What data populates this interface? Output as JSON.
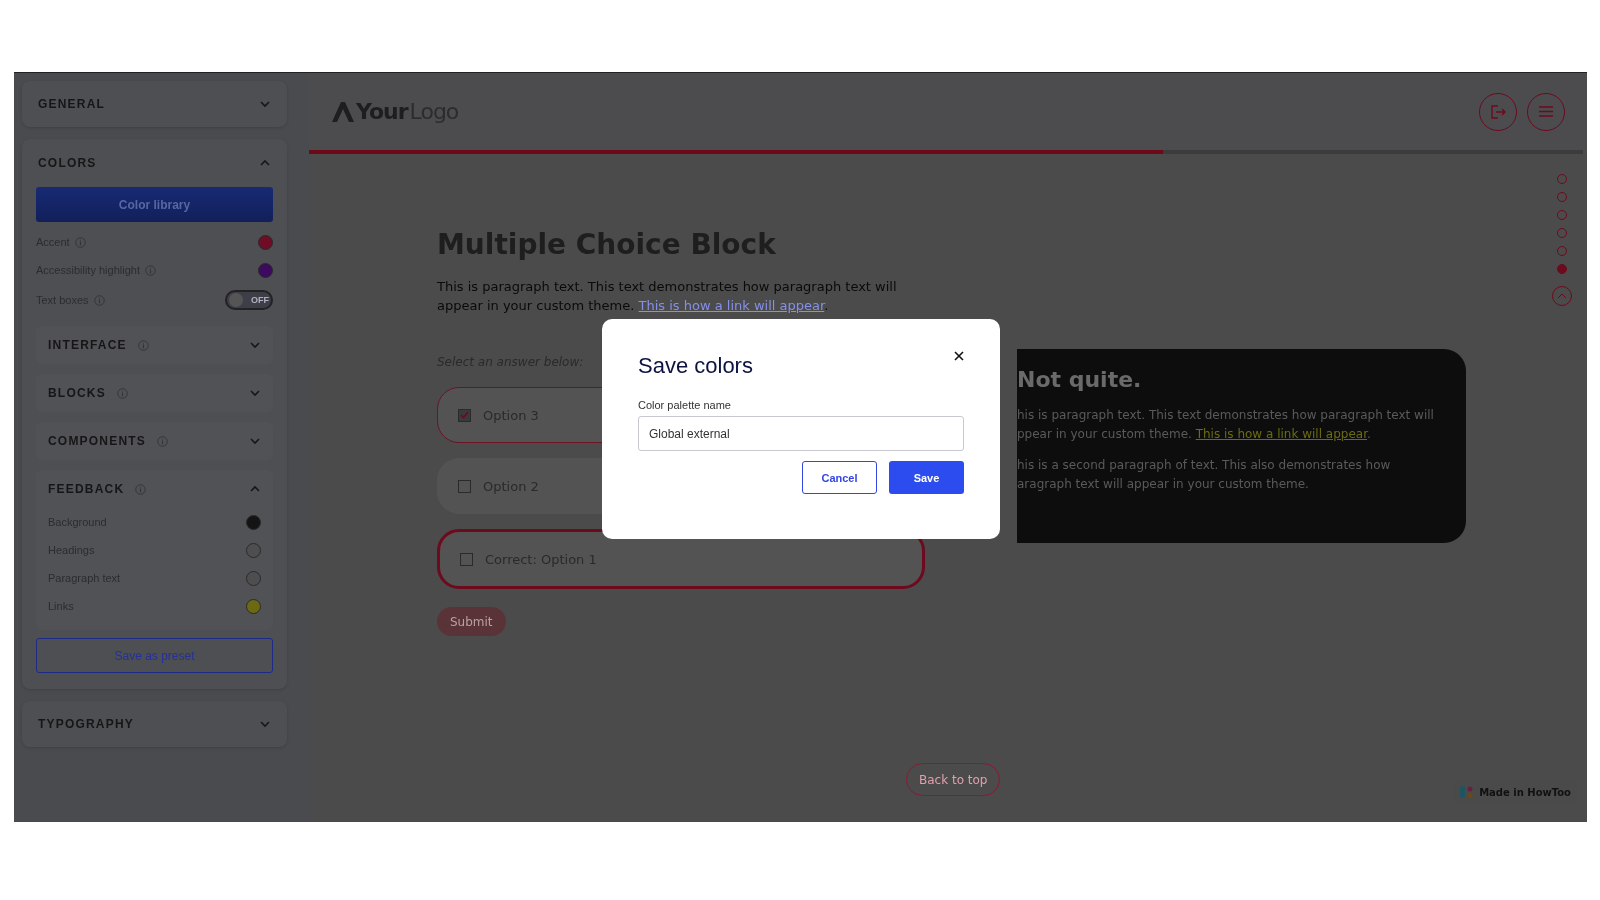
{
  "sidebar": {
    "sections": [
      {
        "title": "GENERAL",
        "expanded": false
      },
      {
        "title": "COLORS",
        "expanded": true,
        "library_button": "Color library",
        "items": [
          {
            "kind": "color",
            "label": "Accent",
            "info": true,
            "color": "#6e0d25"
          },
          {
            "kind": "color",
            "label": "Accessibility highlight",
            "info": true,
            "color": "#3c0a5e"
          },
          {
            "kind": "toggle",
            "label": "Text boxes",
            "info": true,
            "on": false,
            "state_label": "OFF"
          }
        ],
        "subsections": [
          {
            "title": "INTERFACE",
            "info": true,
            "expanded": false
          },
          {
            "title": "BLOCKS",
            "info": true,
            "expanded": false
          },
          {
            "title": "COMPONENTS",
            "info": true,
            "expanded": false
          },
          {
            "title": "FEEDBACK",
            "info": true,
            "expanded": true,
            "items": [
              {
                "kind": "color",
                "label": "Background",
                "info": false,
                "color": "#141414"
              },
              {
                "kind": "color",
                "label": "Headings",
                "info": false,
                "color": "#4e4e50"
              },
              {
                "kind": "color",
                "label": "Paragraph text",
                "info": false,
                "color": "#4e4e50"
              },
              {
                "kind": "color",
                "label": "Links",
                "info": false,
                "color": "#6b6a12"
              }
            ]
          }
        ],
        "preset_button": "Save as preset"
      },
      {
        "title": "TYPOGRAPHY",
        "expanded": false
      }
    ]
  },
  "preview": {
    "logo": {
      "bold": "Your",
      "light": "Logo"
    },
    "progress": {
      "level": 0.67
    },
    "dots": [
      {
        "selected": false
      },
      {
        "selected": false
      },
      {
        "selected": false
      },
      {
        "selected": false
      },
      {
        "selected": false
      },
      {
        "selected": true
      }
    ],
    "heading": "Multiple Choice Block",
    "paragraph": "This is paragraph text. This text demonstrates how paragraph text will appear in your custom theme.",
    "paragraph_link": "This is how a link will appear",
    "paragraph_end": ".",
    "prompt": "Select an answer below:",
    "options": [
      {
        "label": "Option 3",
        "checked": true,
        "kind": "chosen"
      },
      {
        "label": "Option 2",
        "checked": false,
        "kind": "plain"
      },
      {
        "label": "Correct: Option 1",
        "checked": false,
        "kind": "correct"
      }
    ],
    "submit": {
      "label": "Submit",
      "disabled": true
    },
    "feedback": {
      "title": "Not quite.",
      "lines": [
        "his is paragraph text. This text demonstrates how paragraph text will",
        "ppear in your custom theme."
      ],
      "link": "This is how a link will appear",
      "link_end": ".",
      "second_lines": [
        "his is a second paragraph of text. This also demonstrates how",
        "aragraph text will appear in your custom theme."
      ]
    },
    "back_to_top": "Back to top",
    "badge": "Made in HowToo"
  },
  "modal": {
    "title": "Save colors",
    "field_label": "Color palette name",
    "value": "Global external",
    "cancel": "Cancel",
    "save": "Save"
  }
}
